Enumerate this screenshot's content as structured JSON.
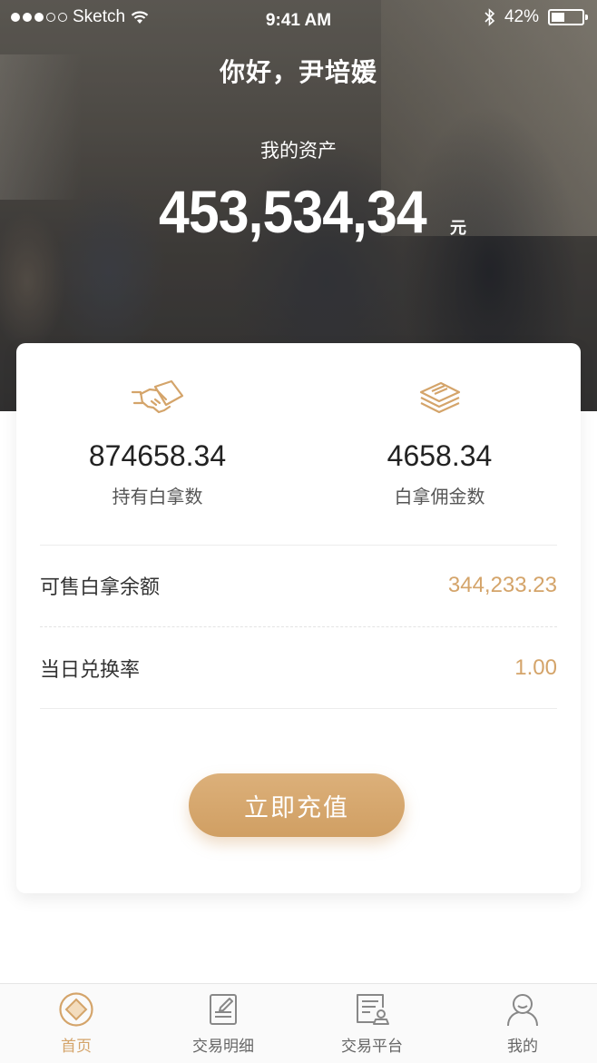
{
  "status_bar": {
    "carrier": "Sketch",
    "time": "9:41 AM",
    "battery": "42%"
  },
  "hero": {
    "greeting": "你好，尹培媛",
    "asset_label": "我的资产",
    "asset_amount": "453,534,34",
    "asset_unit": "元"
  },
  "stats": {
    "left": {
      "value": "874658.34",
      "label": "持有白拿数",
      "icon": "handshake-icon"
    },
    "right": {
      "value": "4658.34",
      "label": "白拿佣金数",
      "icon": "stack-icon"
    }
  },
  "rows": [
    {
      "label": "可售白拿余额",
      "value": "344,233.23"
    },
    {
      "label": "当日兑换率",
      "value": "1.00"
    }
  ],
  "button": {
    "label": "立即充值"
  },
  "tabs": [
    {
      "label": "首页",
      "icon": "home-diamond-icon",
      "active": true
    },
    {
      "label": "交易明细",
      "icon": "document-edit-icon",
      "active": false
    },
    {
      "label": "交易平台",
      "icon": "platform-user-icon",
      "active": false
    },
    {
      "label": "我的",
      "icon": "profile-icon",
      "active": false
    }
  ],
  "colors": {
    "accent": "#d4a46a",
    "tab_inactive": "#888888"
  }
}
